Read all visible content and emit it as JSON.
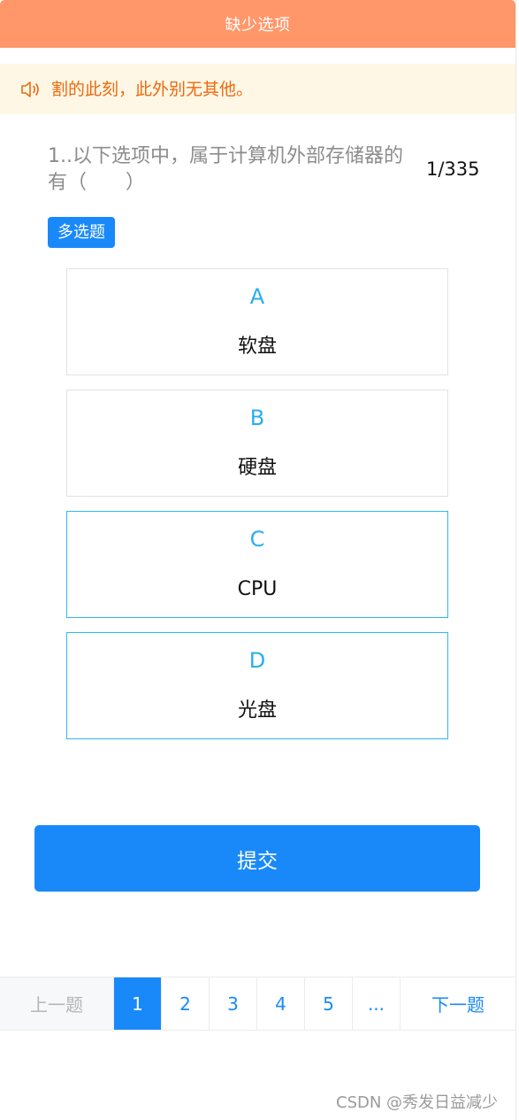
{
  "header": {
    "title": "缺少选项"
  },
  "notice": {
    "icon": "speaker-icon",
    "text": "割的此刻，此外别无其他。"
  },
  "question": {
    "text": "1..以下选项中，属于计算机外部存储器的有（　　）",
    "counter": "1/335",
    "type": "多选题"
  },
  "options": [
    {
      "letter": "A",
      "text": "软盘",
      "selected": false
    },
    {
      "letter": "B",
      "text": "硬盘",
      "selected": false
    },
    {
      "letter": "C",
      "text": "CPU",
      "selected": true
    },
    {
      "letter": "D",
      "text": "光盘",
      "selected": true
    }
  ],
  "submit": {
    "label": "提交"
  },
  "pager": {
    "prev": "上一题",
    "next": "下一题",
    "pages": [
      "1",
      "2",
      "3",
      "4",
      "5",
      "..."
    ],
    "active_page": "1"
  },
  "watermark": "CSDN @秀发日益减少",
  "colors": {
    "header": "#ff976a",
    "primary": "#1989fa",
    "notice_bg": "#fff7e6",
    "notice_text": "#ed6a0c",
    "option_letter": "#27aef0",
    "selected_border": "#2db7f5"
  }
}
